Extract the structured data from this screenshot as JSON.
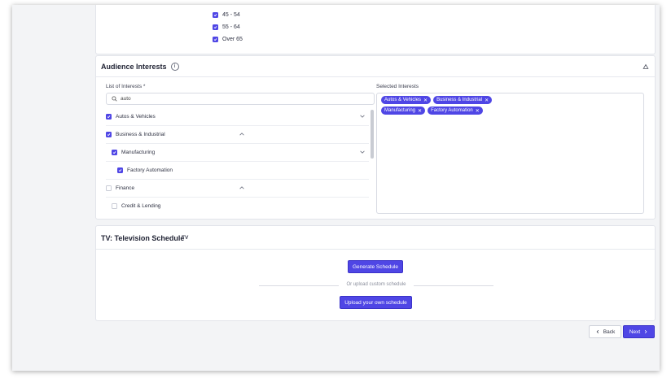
{
  "age_ranges": [
    {
      "label": "45 - 54",
      "checked": true
    },
    {
      "label": "55 - 64",
      "checked": true
    },
    {
      "label": "Over 65",
      "checked": true
    }
  ],
  "interests": {
    "title": "Audience Interests",
    "list_label": "List of Interests *",
    "search_value": "auto",
    "selected_label": "Selected Interests",
    "tree": [
      {
        "label": "Autos & Vehicles",
        "checked": true,
        "level": 0,
        "chevron": "down"
      },
      {
        "label": "Business & Industrial",
        "checked": true,
        "level": 0,
        "chevron": "up"
      },
      {
        "label": "Manufacturing",
        "checked": true,
        "level": 1,
        "chevron": "down"
      },
      {
        "label": "Factory Automation",
        "checked": true,
        "level": 2,
        "chevron": ""
      },
      {
        "label": "Finance",
        "checked": false,
        "level": 0,
        "chevron": "up"
      },
      {
        "label": "Credit & Lending",
        "checked": false,
        "level": 1,
        "chevron": ""
      }
    ],
    "selected": [
      "Autos & Vehicles",
      "Business & Industrial",
      "Manufacturing",
      "Factory Automation"
    ]
  },
  "tv": {
    "title": "TV: Television Schedule",
    "subtitle": "TV",
    "generate_label": "Generate Schedule",
    "or_text": "Or upload custom schedule",
    "upload_label": "Upload your own schedule"
  },
  "nav": {
    "back_label": "Back",
    "next_label": "Next"
  },
  "colors": {
    "accent": "#4f46e5",
    "background": "#f3f4f6"
  }
}
